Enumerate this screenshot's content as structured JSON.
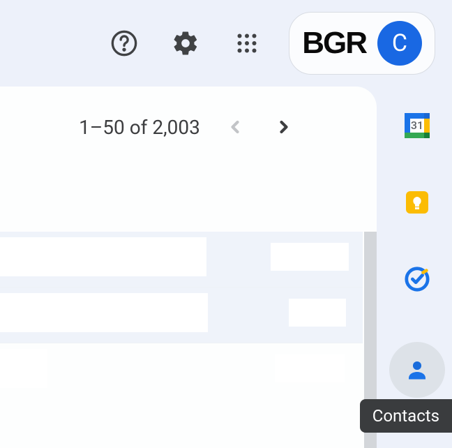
{
  "header": {
    "brand": "BGR",
    "avatar_letter": "C"
  },
  "pagination": {
    "text": "1–50 of 2,003"
  },
  "sidebar": {
    "tooltip": "Contacts",
    "calendar_day": "31"
  }
}
